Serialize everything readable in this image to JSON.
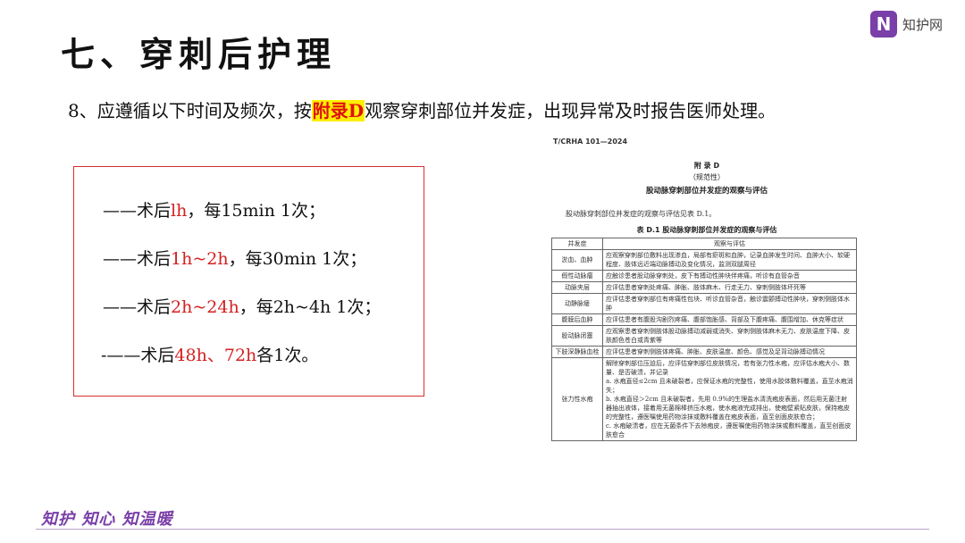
{
  "slide": {
    "title": "七、穿刺后护理",
    "logo_mark": "N",
    "logo_text": "知护网",
    "instruction": {
      "before": "8、应遵循以下时间及频次，按",
      "highlight": "附录D",
      "after": "观察穿刺部位并发症，出现异常及时报告医师处理。"
    },
    "schedule": [
      {
        "prefix": "——术后",
        "t1": "lh",
        "mid": "",
        "t2": "",
        "suffix": "，每15min 1次；"
      },
      {
        "prefix": "——术后",
        "t1": "1h~2h",
        "mid": "",
        "t2": "",
        "suffix": "，每30min 1次；"
      },
      {
        "prefix": "——术后",
        "t1": "2h~24h",
        "mid": "",
        "t2": "",
        "suffix": "，每2h~4h 1次；"
      },
      {
        "prefix": "-——术后",
        "t1": "48h",
        "mid": "、",
        "t2": "72h",
        "suffix": "各1次。"
      }
    ],
    "footer": "知护 知心 知温暖"
  },
  "document": {
    "code": "T/CRHA 101—2024",
    "appendix": "附 录 D",
    "normative": "（规范性）",
    "doc_title": "股动脉穿刺部位并发症的观察与评估",
    "intro": "股动脉穿刺部位并发症的观察与评估见表 D.1。",
    "table_title": "表 D.1  股动脉穿刺部位并发症的观察与评估",
    "headers": [
      "并发症",
      "观察与评估"
    ],
    "rows": [
      {
        "name": "淤血、血肿",
        "desc": "应观察穿刺部位敷料出现渗血，局部有瘀斑和血肿，记录血肿发生时间、血肿大小、软硬程度、肢体远近端动脉搏动及变化情况，监测双腿周径"
      },
      {
        "name": "假性动脉瘤",
        "desc": "应触诊患者股动脉穿刺处，皮下有搏动性肿块伴疼痛，听诊有血管杂音"
      },
      {
        "name": "动脉夹层",
        "desc": "应评估患者穿刺处疼痛、肿胀、肢体麻木、行走无力、穿刺侧肢体坏死等"
      },
      {
        "name": "动静脉瘘",
        "desc": "应评估患者穿刺部位有疼痛性包块、听诊血管杂音，触诊震颤搏动性肿块，穿刺侧肢体水肿"
      },
      {
        "name": "腹膜后血肿",
        "desc": "应评估患者有腹股沟剧烈疼痛、腹部饱胀感、背部及下腹疼痛、腹围增加、休克等症状"
      },
      {
        "name": "股动脉闭塞",
        "desc": "应观察患者穿刺侧肢体股动脉搏动减弱或消失、穿刺侧肢体麻木无力、皮肤温度下降、皮肤颜色苍白或青紫等"
      },
      {
        "name": "下肢深静脉血栓",
        "desc": "应评估患者穿刺侧肢体疼痛、肿胀、皮肤温度、颜色、感觉及足背动脉搏动情况"
      },
      {
        "name": "张力性水疱",
        "desc": "解除穿刺部位压迫后，应评估穿刺部位皮肤情况，若有张力性水疱，应评估水疱大小、数量、是否破溃，并记录\na. 水疱直径≤2cm 且未破裂者，应保证水疱的完整性，使用水胶体敷料覆盖，直至水疱消失；\nb. 水疱直径＞2cm 且未破裂者，先用 0.9%的生理盐水清洗疱皮表面，然后用无菌注射器抽出液体，接着用无菌棉棒挤压水疱，使水疱液完成排出，使疱壁紧贴皮肤，保持疱皮的完整性，遵医嘱使用药物涂抹或敷料覆盖在疱皮表面，直至创面皮肤愈合；\nc. 水疱破溃者，应在无菌条件下去除疱皮，遵医嘱使用药物涂抹或敷料覆盖，直至创面皮肤愈合"
      }
    ]
  }
}
